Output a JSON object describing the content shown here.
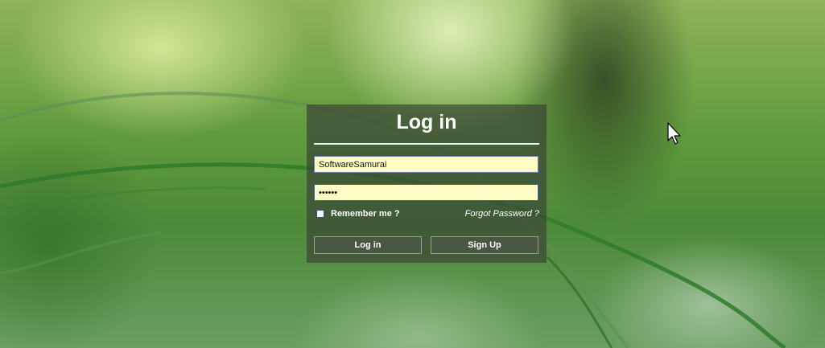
{
  "login_form": {
    "title": "Log in",
    "username_value": "SoftwareSamurai",
    "password_value": "••••••",
    "remember_label": "Remember me ?",
    "remember_checked": false,
    "forgot_label": "Forgot Password ?",
    "login_button_label": "Log in",
    "signup_button_label": "Sign Up"
  },
  "colors": {
    "input_background": "#fcfcc4",
    "panel_background": "#3c4637",
    "text": "#ffffff"
  },
  "icons": {
    "cursor": "mouse-pointer-icon"
  }
}
